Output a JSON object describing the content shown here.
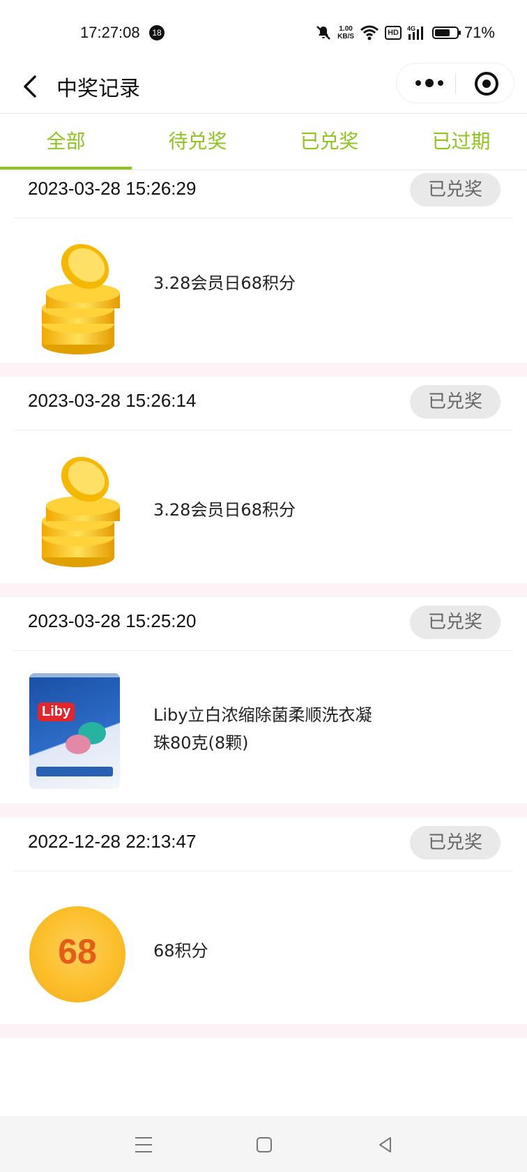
{
  "status_bar": {
    "time": "17:27:08",
    "notification_count": "18",
    "net_speed_value": "1.00",
    "net_speed_unit": "KB/S",
    "hd_label": "HD",
    "network_type": "4G",
    "battery_level": 0.71,
    "battery_text": "71%"
  },
  "nav": {
    "title": "中奖记录"
  },
  "tabs": [
    {
      "label": "全部",
      "active": true
    },
    {
      "label": "待兑奖",
      "active": false
    },
    {
      "label": "已兑奖",
      "active": false
    },
    {
      "label": "已过期",
      "active": false
    }
  ],
  "records": [
    {
      "date": "2023-03-28 15:26:29",
      "status": "已兑奖",
      "name": "3.28会员日68积分",
      "image": "gold-coins"
    },
    {
      "date": "2023-03-28 15:26:14",
      "status": "已兑奖",
      "name": "3.28会员日68积分",
      "image": "gold-coins"
    },
    {
      "date": "2023-03-28 15:25:20",
      "status": "已兑奖",
      "name": "Liby立白浓缩除菌柔顺洗衣凝珠80克(8颗)",
      "image": "detergent-pack",
      "brand_text": "Liby"
    },
    {
      "date": "2022-12-28 22:13:47",
      "status": "已兑奖",
      "name": "68积分",
      "image": "points-badge",
      "badge_number": "68"
    }
  ],
  "colors": {
    "accent": "#8fc31f",
    "separator": "#fbf3f5",
    "badge_bg": "#e9e9e9",
    "coin": "#f7c325"
  }
}
